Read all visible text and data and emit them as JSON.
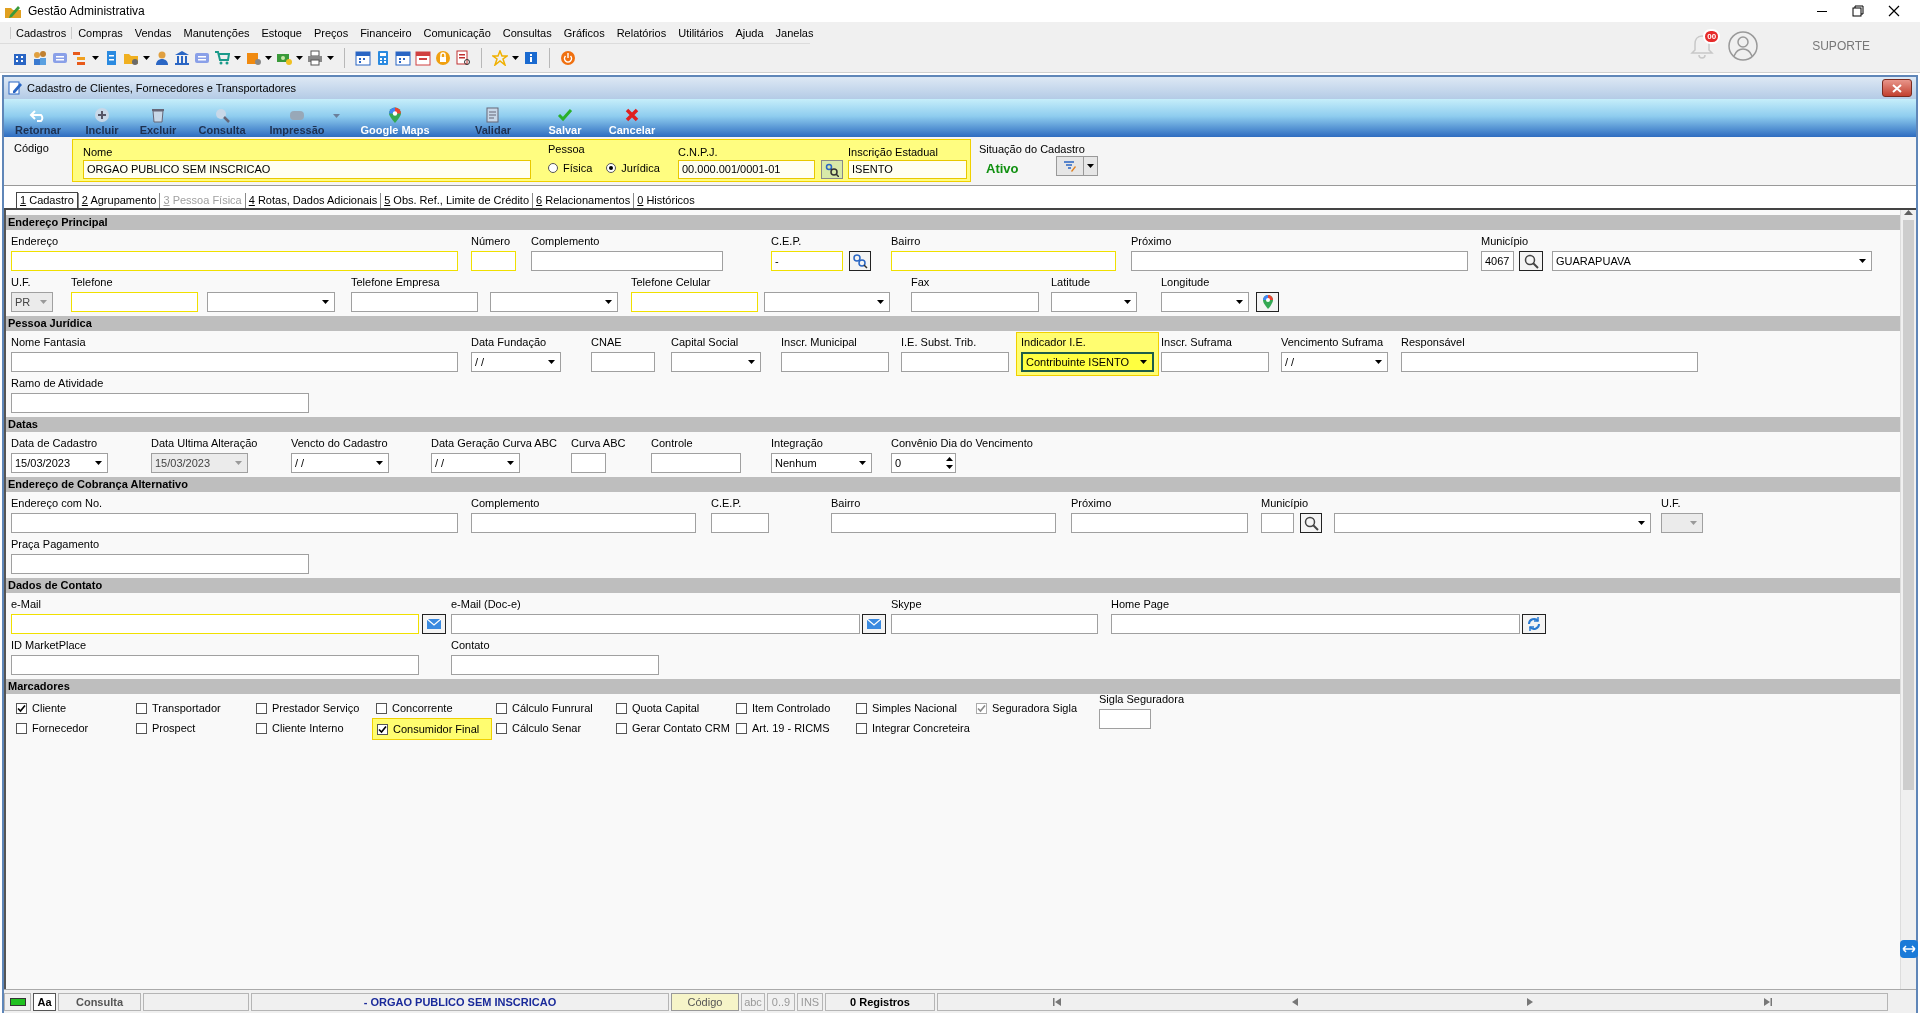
{
  "window": {
    "title": "Gestão Administrativa"
  },
  "menu": [
    {
      "label": "Cadastros",
      "selected": true
    },
    {
      "label": "Compras",
      "selected": false
    },
    {
      "label": "Vendas",
      "selected": false
    },
    {
      "label": "Manutenções",
      "selected": false
    },
    {
      "label": "Estoque",
      "selected": false
    },
    {
      "label": "Preços",
      "selected": false
    },
    {
      "label": "Financeiro",
      "selected": false
    },
    {
      "label": "Comunicação",
      "selected": false
    },
    {
      "label": "Consultas",
      "selected": false
    },
    {
      "label": "Gráficos",
      "selected": false
    },
    {
      "label": "Relatórios",
      "selected": false
    },
    {
      "label": "Utilitários",
      "selected": false
    },
    {
      "label": "Ajuda",
      "selected": false
    },
    {
      "label": "Janelas",
      "selected": false
    }
  ],
  "user_area": {
    "notification_count": "00",
    "user_label": "SUPORTE"
  },
  "form_window": {
    "title": "Cadastro de Clientes, Fornecedores e Transportadores"
  },
  "actions": [
    {
      "label": "Retornar",
      "kind": "back",
      "disabled": true,
      "dropdown": false
    },
    {
      "label": "Incluir",
      "kind": "add",
      "disabled": true,
      "dropdown": false
    },
    {
      "label": "Excluir",
      "kind": "delete",
      "disabled": true,
      "dropdown": false
    },
    {
      "label": "Consulta",
      "kind": "search",
      "disabled": true,
      "dropdown": false
    },
    {
      "label": "Impressão",
      "kind": "print",
      "disabled": true,
      "dropdown": true
    },
    {
      "label": "Google Maps",
      "kind": "map",
      "disabled": false,
      "dropdown": false
    },
    {
      "label": "Validar",
      "kind": "validate",
      "disabled": true,
      "dropdown": false
    },
    {
      "label": "Salvar",
      "kind": "save",
      "disabled": false,
      "dropdown": false
    },
    {
      "label": "Cancelar",
      "kind": "cancel",
      "disabled": false,
      "dropdown": false
    }
  ],
  "header": {
    "code_label": "Código",
    "name": {
      "label": "Nome",
      "value": "ORGAO PUBLICO SEM INSCRICAO"
    },
    "person_type": {
      "label": "Pessoa",
      "options": [
        {
          "label": "Física",
          "selected": false
        },
        {
          "label": "Jurídica",
          "selected": true
        }
      ]
    },
    "cnpj": {
      "label": "C.N.P.J.",
      "value": "00.000.001/0001-01"
    },
    "state_registration": {
      "label": "Inscrição Estadual",
      "value": "ISENTO"
    },
    "status": {
      "label": "Situação do Cadastro",
      "value": "Ativo"
    }
  },
  "tabs": [
    {
      "label": "1 Cadastro",
      "selected": true,
      "disabled": false
    },
    {
      "label": "2 Agrupamento",
      "selected": false,
      "disabled": false
    },
    {
      "label": "3 Pessoa Física",
      "selected": false,
      "disabled": true
    },
    {
      "label": "4 Rotas, Dados Adicionais",
      "selected": false,
      "disabled": false
    },
    {
      "label": "5 Obs. Ref., Limite de Crédito",
      "selected": false,
      "disabled": false
    },
    {
      "label": "6 Relacionamentos",
      "selected": false,
      "disabled": false
    },
    {
      "label": "0 Históricos",
      "selected": false,
      "disabled": false
    }
  ],
  "sections": [
    {
      "title": "Endereço Principal",
      "rows": [
        [
          {
            "label": "Endereço",
            "highlighted": false,
            "controls": [
              {
                "kind": "text",
                "required": true,
                "disabled": false
              }
            ]
          },
          {
            "label": "Número",
            "highlighted": false,
            "controls": [
              {
                "kind": "text",
                "required": true,
                "disabled": false
              }
            ]
          },
          {
            "label": "Complemento",
            "highlighted": false,
            "controls": [
              {
                "kind": "text",
                "required": false,
                "disabled": false
              }
            ]
          },
          {
            "label": "C.E.P.",
            "highlighted": false,
            "controls": [
              {
                "kind": "text",
                "value": "-",
                "required": true,
                "disabled": false
              },
              {
                "kind": "cepsearch",
                "required": false,
                "disabled": false
              }
            ]
          },
          {
            "label": "Bairro",
            "highlighted": false,
            "controls": [
              {
                "kind": "text",
                "required": true,
                "disabled": false
              }
            ]
          },
          {
            "label": "Próximo",
            "highlighted": false,
            "controls": [
              {
                "kind": "text",
                "required": false,
                "disabled": false
              }
            ]
          },
          {
            "label": "Município",
            "highlighted": false,
            "controls": [
              {
                "kind": "text",
                "value": "4067",
                "required": false,
                "disabled": false
              },
              {
                "kind": "search",
                "required": false,
                "disabled": false
              },
              {
                "kind": "combo",
                "value": "GUARAPUAVA",
                "required": false,
                "disabled": false
              }
            ]
          }
        ],
        [
          {
            "label": "U.F.",
            "highlighted": false,
            "controls": [
              {
                "kind": "combo",
                "value": "PR",
                "required": false,
                "disabled": true
              }
            ]
          },
          {
            "label": "Telefone",
            "highlighted": false,
            "controls": [
              {
                "kind": "text",
                "required": true,
                "disabled": false
              },
              {
                "kind": "combo",
                "required": false,
                "disabled": false
              }
            ]
          },
          {
            "label": "Telefone Empresa",
            "highlighted": false,
            "controls": [
              {
                "kind": "text",
                "required": false,
                "disabled": false
              },
              {
                "kind": "combo",
                "required": false,
                "disabled": false
              }
            ]
          },
          {
            "label": "Telefone Celular",
            "highlighted": false,
            "controls": [
              {
                "kind": "text",
                "required": true,
                "disabled": false
              },
              {
                "kind": "combo",
                "required": false,
                "disabled": false
              }
            ]
          },
          {
            "label": "Fax",
            "highlighted": false,
            "controls": [
              {
                "kind": "text",
                "required": false,
                "disabled": false
              }
            ]
          },
          {
            "label": "Latitude",
            "highlighted": false,
            "controls": [
              {
                "kind": "combo",
                "required": false,
                "disabled": false
              }
            ]
          },
          {
            "label": "Longitude",
            "highlighted": false,
            "controls": [
              {
                "kind": "combo",
                "required": false,
                "disabled": false
              },
              {
                "kind": "map",
                "required": false,
                "disabled": false
              }
            ]
          }
        ]
      ]
    },
    {
      "title": "Pessoa Jurídica",
      "rows": [
        [
          {
            "label": "Nome Fantasia",
            "highlighted": false,
            "controls": [
              {
                "kind": "text",
                "required": false,
                "disabled": false
              }
            ]
          },
          {
            "label": "Data Fundação",
            "highlighted": false,
            "controls": [
              {
                "kind": "date",
                "value": "/ /",
                "required": false,
                "disabled": false
              }
            ]
          },
          {
            "label": "CNAE",
            "highlighted": false,
            "controls": [
              {
                "kind": "text",
                "required": false,
                "disabled": false
              }
            ]
          },
          {
            "label": "Capital Social",
            "highlighted": false,
            "controls": [
              {
                "kind": "combo",
                "required": false,
                "disabled": false
              }
            ]
          },
          {
            "label": "Inscr. Municipal",
            "highlighted": false,
            "controls": [
              {
                "kind": "text",
                "required": false,
                "disabled": false
              }
            ]
          },
          {
            "label": "I.E. Subst. Trib.",
            "highlighted": false,
            "controls": [
              {
                "kind": "text",
                "required": false,
                "disabled": false
              }
            ]
          },
          {
            "label": "Indicador I.E.",
            "highlighted": true,
            "controls": [
              {
                "kind": "combo",
                "value": "Contribuinte ISENTO",
                "required": false,
                "disabled": false
              }
            ]
          },
          {
            "label": "Inscr. Suframa",
            "highlighted": false,
            "controls": [
              {
                "kind": "text",
                "required": false,
                "disabled": false
              }
            ]
          },
          {
            "label": "Vencimento Suframa",
            "highlighted": false,
            "controls": [
              {
                "kind": "date",
                "value": "/ /",
                "required": false,
                "disabled": false
              }
            ]
          },
          {
            "label": "Responsável",
            "highlighted": false,
            "controls": [
              {
                "kind": "text",
                "required": false,
                "disabled": false
              }
            ]
          }
        ],
        [
          {
            "label": "Ramo de Atividade",
            "highlighted": false,
            "controls": [
              {
                "kind": "text",
                "required": false,
                "disabled": false
              }
            ]
          }
        ]
      ]
    },
    {
      "title": "Datas",
      "rows": [
        [
          {
            "label": "Data de Cadastro",
            "highlighted": false,
            "controls": [
              {
                "kind": "date",
                "value": "15/03/2023",
                "required": false,
                "disabled": false
              }
            ]
          },
          {
            "label": "Data Ultima Alteração",
            "highlighted": false,
            "controls": [
              {
                "kind": "date",
                "value": "15/03/2023",
                "required": false,
                "disabled": true
              }
            ]
          },
          {
            "label": "Vencto do Cadastro",
            "highlighted": false,
            "controls": [
              {
                "kind": "date",
                "value": "/ /",
                "required": false,
                "disabled": false
              }
            ]
          },
          {
            "label": "Data Geração Curva ABC",
            "highlighted": false,
            "controls": [
              {
                "kind": "date",
                "value": "/ /",
                "required": false,
                "disabled": false
              }
            ]
          },
          {
            "label": "Curva ABC",
            "highlighted": false,
            "controls": [
              {
                "kind": "text",
                "required": false,
                "disabled": false
              }
            ]
          },
          {
            "label": "Controle",
            "highlighted": false,
            "controls": [
              {
                "kind": "text",
                "required": false,
                "disabled": false
              }
            ]
          },
          {
            "label": "Integração",
            "highlighted": false,
            "controls": [
              {
                "kind": "combo",
                "value": "Nenhum",
                "required": false,
                "disabled": false
              }
            ]
          },
          {
            "label": "Convênio Dia do Vencimento",
            "highlighted": false,
            "controls": [
              {
                "kind": "spin",
                "value": "0",
                "required": false,
                "disabled": false
              }
            ]
          }
        ]
      ]
    },
    {
      "title": "Endereço de Cobrança Alternativo",
      "rows": [
        [
          {
            "label": "Endereço com No.",
            "highlighted": false,
            "controls": [
              {
                "kind": "text",
                "required": false,
                "disabled": false
              }
            ]
          },
          {
            "label": "Complemento",
            "highlighted": false,
            "controls": [
              {
                "kind": "text",
                "required": false,
                "disabled": false
              }
            ]
          },
          {
            "label": "C.E.P.",
            "highlighted": false,
            "controls": [
              {
                "kind": "text",
                "required": false,
                "disabled": false
              }
            ]
          },
          {
            "label": "Bairro",
            "highlighted": false,
            "controls": [
              {
                "kind": "text",
                "required": false,
                "disabled": false
              }
            ]
          },
          {
            "label": "Próximo",
            "highlighted": false,
            "controls": [
              {
                "kind": "text",
                "required": false,
                "disabled": false
              }
            ]
          },
          {
            "label": "Município",
            "highlighted": false,
            "controls": [
              {
                "kind": "text",
                "required": false,
                "disabled": false
              },
              {
                "kind": "search",
                "required": false,
                "disabled": false
              },
              {
                "kind": "combo",
                "required": false,
                "disabled": false
              }
            ]
          },
          {
            "label": "U.F.",
            "highlighted": false,
            "controls": [
              {
                "kind": "combo",
                "required": false,
                "disabled": true
              }
            ]
          }
        ],
        [
          {
            "label": "Praça Pagamento",
            "highlighted": false,
            "controls": [
              {
                "kind": "text",
                "required": false,
                "disabled": false
              }
            ]
          }
        ]
      ]
    },
    {
      "title": "Dados de Contato",
      "rows": [
        [
          {
            "label": "e-Mail",
            "highlighted": false,
            "controls": [
              {
                "kind": "text",
                "required": true,
                "disabled": false
              },
              {
                "kind": "mail",
                "required": false,
                "disabled": false
              }
            ]
          },
          {
            "label": "e-Mail (Doc-e)",
            "highlighted": false,
            "controls": [
              {
                "kind": "text",
                "required": false,
                "disabled": false
              },
              {
                "kind": "mail",
                "required": false,
                "disabled": false
              }
            ]
          },
          {
            "label": "Skype",
            "highlighted": false,
            "controls": [
              {
                "kind": "text",
                "required": false,
                "disabled": false
              }
            ]
          },
          {
            "label": "Home Page",
            "highlighted": false,
            "controls": [
              {
                "kind": "text",
                "required": false,
                "disabled": false
              },
              {
                "kind": "link",
                "required": false,
                "disabled": false
              }
            ]
          }
        ],
        [
          {
            "label": "ID MarketPlace",
            "highlighted": false,
            "controls": [
              {
                "kind": "text",
                "required": false,
                "disabled": false
              }
            ]
          },
          {
            "label": "Contato",
            "highlighted": false,
            "controls": [
              {
                "kind": "text",
                "required": false,
                "disabled": false
              }
            ]
          }
        ]
      ]
    }
  ],
  "markers": {
    "title": "Marcadores",
    "checkboxes": [
      {
        "label": "Cliente",
        "checked": true,
        "disabled": false,
        "highlighted": false
      },
      {
        "label": "Transportador",
        "checked": false,
        "disabled": false,
        "highlighted": false
      },
      {
        "label": "Prestador Serviço",
        "checked": false,
        "disabled": false,
        "highlighted": false
      },
      {
        "label": "Concorrente",
        "checked": false,
        "disabled": false,
        "highlighted": false
      },
      {
        "label": "Cálculo Funrural",
        "checked": false,
        "disabled": false,
        "highlighted": false
      },
      {
        "label": "Quota Capital",
        "checked": false,
        "disabled": false,
        "highlighted": false
      },
      {
        "label": "Item Controlado",
        "checked": false,
        "disabled": false,
        "highlighted": false
      },
      {
        "label": "Simples Nacional",
        "checked": false,
        "disabled": false,
        "highlighted": false
      },
      {
        "label": "Seguradora Sigla",
        "checked": true,
        "disabled": true,
        "highlighted": false
      },
      {
        "label": "Fornecedor",
        "checked": false,
        "disabled": false,
        "highlighted": false
      },
      {
        "label": "Prospect",
        "checked": false,
        "disabled": false,
        "highlighted": false
      },
      {
        "label": "Cliente Interno",
        "checked": false,
        "disabled": false,
        "highlighted": false
      },
      {
        "label": "Consumidor Final",
        "checked": true,
        "disabled": false,
        "highlighted": true
      },
      {
        "label": "Cálculo Senar",
        "checked": false,
        "disabled": false,
        "highlighted": false
      },
      {
        "label": "Gerar Contato CRM",
        "checked": false,
        "disabled": false,
        "highlighted": false
      },
      {
        "label": "Art. 19 - RICMS",
        "checked": false,
        "disabled": false,
        "highlighted": false
      },
      {
        "label": "Integrar Concreteira",
        "checked": false,
        "disabled": false,
        "highlighted": false
      }
    ],
    "extra_field": {
      "label": "Sigla Seguradora"
    }
  },
  "status_bar": [
    {
      "kind": "light"
    },
    {
      "kind": "key",
      "text": "Aa"
    },
    {
      "kind": "mode",
      "text": "Consulta"
    },
    {
      "kind": "blank"
    },
    {
      "kind": "record",
      "text": "- ORGAO PUBLICO SEM INSCRICAO"
    },
    {
      "kind": "order",
      "text": "Código"
    },
    {
      "kind": "dim",
      "text": "abc"
    },
    {
      "kind": "dim",
      "text": "0..9"
    },
    {
      "kind": "dim",
      "text": "INS"
    },
    {
      "kind": "count",
      "text": "0 Registros"
    },
    {
      "kind": "nav"
    }
  ]
}
